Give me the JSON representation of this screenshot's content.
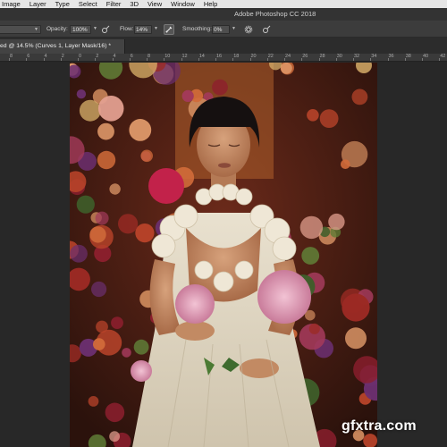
{
  "menu": [
    "Image",
    "Layer",
    "Type",
    "Select",
    "Filter",
    "3D",
    "View",
    "Window",
    "Help"
  ],
  "window": {
    "title": "Adobe Photoshop CC 2018"
  },
  "options": {
    "mode_label": "Mode:",
    "opacity_label": "Opacity:",
    "opacity_value": "100%",
    "flow_label": "Flow:",
    "flow_value": "14%",
    "smoothing_label": "Smoothing:",
    "smoothing_value": "0%"
  },
  "document": {
    "tab_label": "ed @ 14.5% (Curves 1, Layer Mask/16) *"
  },
  "ruler": [
    "8",
    "6",
    "4",
    "2",
    "0",
    "2",
    "4",
    "6",
    "8",
    "10",
    "12",
    "14",
    "16",
    "18",
    "20",
    "22",
    "24",
    "26",
    "28",
    "30",
    "32",
    "34",
    "36",
    "38",
    "40",
    "42"
  ],
  "watermark": "gfxtra.com"
}
